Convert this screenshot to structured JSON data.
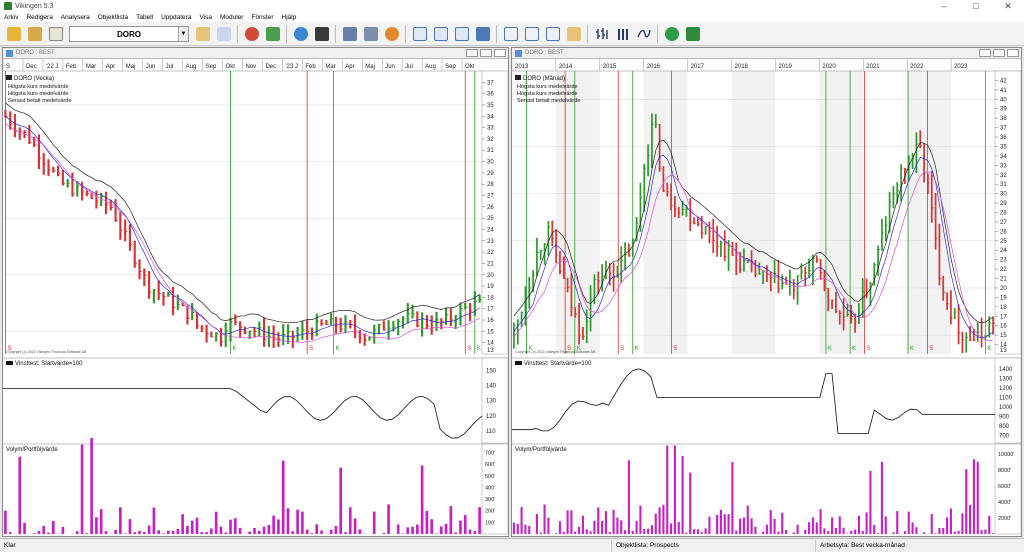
{
  "app": {
    "title": "Vikingen 5.3"
  },
  "menu": [
    "Arkiv",
    "Redigera",
    "Analysera",
    "Objektlista",
    "Tabell",
    "Uppdatera",
    "Visa",
    "Moduler",
    "Fönster",
    "Hjälp"
  ],
  "toolbar": {
    "symbol": "DORO"
  },
  "status": {
    "left": "Klar",
    "list": "Objektlista: Prospects",
    "workspace": "Arbetsyta: Best vecka-månad"
  },
  "colors": {
    "up": "#2e9a2e",
    "down": "#d93232",
    "avg_long": "#222222",
    "avg_short": "#2b2bd6",
    "avg_paid": "#e04ae0",
    "volume": "#c81ec8",
    "buy_line": "#22a022",
    "sell_line": "#e03030"
  },
  "left": {
    "window_title": "DORO : BEST",
    "period_label": "DORO (Vecka)",
    "legend": [
      "Högsta kurs medelvärde",
      "Högsta kurs medelvärde",
      "Senast betalt medelvärde"
    ],
    "copyright": "Copyright (c) 2023 Vikingen Financial Software AB",
    "time_labels": [
      "S",
      "Dec",
      "'22 J",
      "Feb",
      "Mar",
      "Apr",
      "Maj",
      "Jun",
      "Jul",
      "Aug",
      "Sep",
      "Okt",
      "Nov",
      "Dec",
      "'23 J",
      "Feb",
      "Mar",
      "Apr",
      "Maj",
      "Jun",
      "Jul",
      "Aug",
      "Sep",
      "Okt"
    ],
    "price_axis": [
      14,
      15,
      16,
      17,
      18,
      19,
      20,
      21,
      22,
      23,
      24,
      25,
      26,
      27,
      28,
      29,
      30,
      31,
      32,
      33,
      34,
      35,
      36,
      37
    ],
    "price_axis_min_label": "13",
    "signals": [
      "S",
      "K",
      "S",
      "K",
      "S",
      "K"
    ],
    "profit_title": "Vinsttest: Startvärde=100",
    "profit_axis": [
      110,
      120,
      130,
      140,
      150
    ],
    "volume_title": "Volym/Portföljvärde",
    "volume_axis": [
      "100'",
      "200'",
      "300'",
      "400'",
      "500'",
      "600'",
      "700'"
    ]
  },
  "right": {
    "window_title": "DORO : BEST",
    "period_label": "DORO (Månad)",
    "legend": [
      "Högsta kurs medelvärde",
      "Högsta kurs medelvärde",
      "Senast betalt medelvärde"
    ],
    "copyright": "Copyright (c) 2023 Vikingen Financial Software AB",
    "time_labels": [
      "2013",
      "2014",
      "2015",
      "2016",
      "2017",
      "2018",
      "2019",
      "2020",
      "2021",
      "2022",
      "2023"
    ],
    "price_axis": [
      14,
      15,
      16,
      17,
      18,
      19,
      20,
      21,
      22,
      23,
      24,
      25,
      26,
      27,
      28,
      29,
      30,
      31,
      32,
      33,
      34,
      35,
      36,
      37,
      38,
      39,
      40,
      41,
      42
    ],
    "price_axis_min_label": "13",
    "signals": [
      "K",
      "S",
      "K",
      "S",
      "K",
      "S",
      "K",
      "K",
      "S",
      "K",
      "S",
      "K"
    ],
    "profit_title": "Vinsttest: Startvärde=100",
    "profit_axis": [
      700,
      800,
      900,
      1000,
      1100,
      1200,
      1300,
      1400
    ],
    "volume_title": "Volym/Portföljvärde",
    "volume_axis": [
      "2000'",
      "4000'",
      "6000'",
      "8000'",
      "10000'"
    ]
  }
}
